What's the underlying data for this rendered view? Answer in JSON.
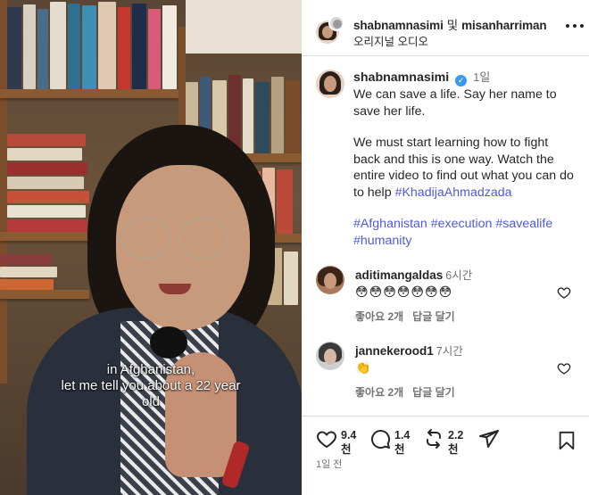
{
  "video": {
    "caption_lines": [
      "in Afghanistan,",
      "let me tell you about a 22 year",
      "old"
    ]
  },
  "header": {
    "username_primary": "shabnamnasimi",
    "connector": "및",
    "username_secondary": "misanharriman",
    "audio_label": "오리지널 오디오"
  },
  "post_caption": {
    "username": "shabnamnasimi",
    "verified_icon": "verified-badge-icon",
    "age": "1일",
    "para1": "We can save a life. Say her name to save her life.",
    "para2": "We must start learning how to fight back and this is one way. Watch the entire video to find out what you can do to help",
    "para2_tag": "#KhadijaAhmadzada",
    "tags": [
      "#Afghanistan",
      "#execution",
      "#savealife",
      "#humanity"
    ]
  },
  "comments": [
    {
      "username": "aditimangaldas",
      "time": "6시간",
      "text": "😳😳😳😳😳😳😳",
      "likes_label": "좋아요 2개",
      "reply_label": "답글 달기"
    },
    {
      "username": "jannekerood1",
      "time": "7시간",
      "text": "👏",
      "likes_label": "좋아요 2개",
      "reply_label": "답글 달기"
    }
  ],
  "actions": {
    "likes": [
      "9.4",
      "천"
    ],
    "comments": [
      "1.4",
      "천"
    ],
    "reposts": [
      "2.2",
      "천"
    ],
    "icons": [
      "heart-icon",
      "comment-icon",
      "repost-icon",
      "share-icon",
      "bookmark-icon"
    ]
  },
  "post_date": "1일 전",
  "colors": {
    "hashtag": "#4f5bd5",
    "verified": "#3897f0",
    "muted": "#737373"
  }
}
